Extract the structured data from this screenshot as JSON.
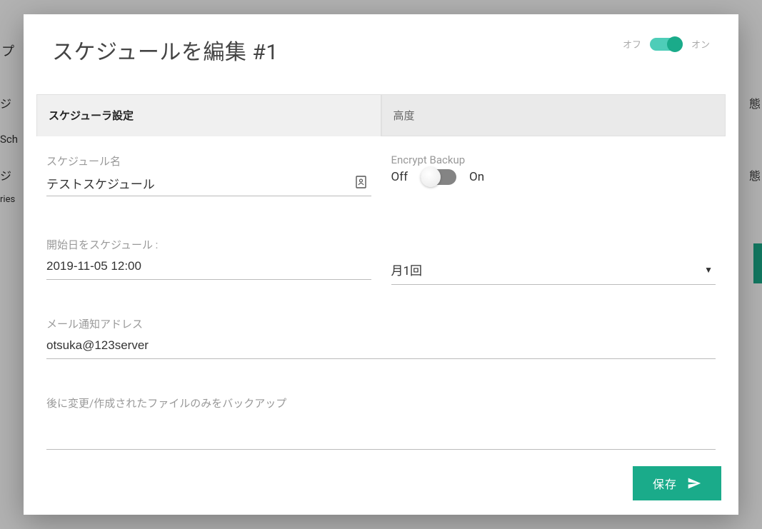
{
  "header": {
    "title": "スケジュールを編集 #1",
    "toggle": {
      "off_label": "オフ",
      "on_label": "オン",
      "state": "on"
    }
  },
  "tabs": {
    "settings": "スケジューラ設定",
    "advanced": "高度"
  },
  "fields": {
    "schedule_name": {
      "label": "スケジュール名",
      "value": "テストスケジュール"
    },
    "encrypt": {
      "label": "Encrypt Backup",
      "off": "Off",
      "on": "On",
      "state": "off"
    },
    "start_date": {
      "label": "開始日をスケジュール :",
      "value": "2019-11-05 12:00"
    },
    "frequency": {
      "value": "月1回"
    },
    "email": {
      "label": "メール通知アドレス",
      "value": "otsuka@123server"
    },
    "incremental": {
      "label": "後に変更/作成されたファイルのみをバックアップ"
    }
  },
  "footer": {
    "save": "保存"
  },
  "background": {
    "left1": "プ",
    "left2": "ジ",
    "left3": "Sch",
    "left4": "ジ",
    "left5": "ries",
    "right1": "態",
    "right2": "態"
  }
}
